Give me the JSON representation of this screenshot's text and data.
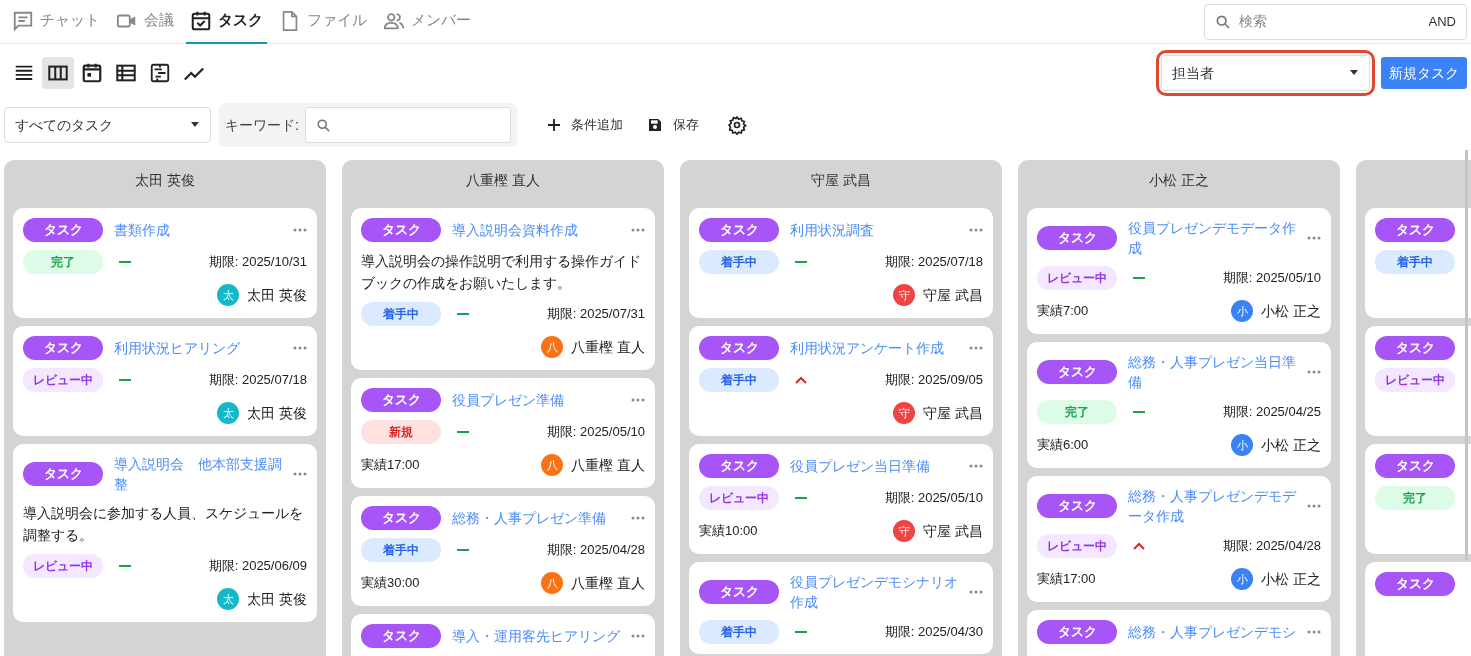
{
  "tabs": [
    {
      "label": "チャット",
      "kind": "chat",
      "selected": false
    },
    {
      "label": "会議",
      "kind": "video",
      "selected": false
    },
    {
      "label": "タスク",
      "kind": "task",
      "selected": true
    },
    {
      "label": "ファイル",
      "kind": "file",
      "selected": false
    },
    {
      "label": "メンバー",
      "kind": "members",
      "selected": false
    }
  ],
  "search": {
    "placeholder": "検索",
    "mode": "AND"
  },
  "view_modes": [
    {
      "kind": "list",
      "selected": false
    },
    {
      "kind": "board",
      "selected": true
    },
    {
      "kind": "calendar",
      "selected": false
    },
    {
      "kind": "table",
      "selected": false
    },
    {
      "kind": "gantt",
      "selected": false
    },
    {
      "kind": "chart",
      "selected": false
    }
  ],
  "group_by": {
    "value": "担当者",
    "highlighted": true
  },
  "new_task_button": "新規タスク",
  "filter": {
    "preset": "すべてのタスク",
    "keyword_label": "キーワード:",
    "add_condition": "条件追加",
    "save": "保存"
  },
  "columns": [
    {
      "title": "太田 英俊",
      "cards": [
        {
          "tag": "タスク",
          "title": "書類作成",
          "status": {
            "label": "完了",
            "kind": "done"
          },
          "priority": {
            "kind": "normal"
          },
          "due": "期限: 2025/10/31",
          "assignee": {
            "initial": "太",
            "name": "太田 英俊",
            "color": "#14b8c8"
          }
        },
        {
          "tag": "タスク",
          "title": "利用状況ヒアリング",
          "status": {
            "label": "レビュー中",
            "kind": "review"
          },
          "priority": {
            "kind": "normal"
          },
          "due": "期限: 2025/07/18",
          "assignee": {
            "initial": "太",
            "name": "太田 英俊",
            "color": "#14b8c8"
          }
        },
        {
          "tag": "タスク",
          "title": "導入説明会　他本部支援調整",
          "description": "導入説明会に参加する人員、スケジュールを調整する。",
          "status": {
            "label": "レビュー中",
            "kind": "review"
          },
          "priority": {
            "kind": "normal"
          },
          "due": "期限: 2025/06/09",
          "assignee": {
            "initial": "太",
            "name": "太田 英俊",
            "color": "#14b8c8"
          }
        }
      ]
    },
    {
      "title": "八重樫 直人",
      "cards": [
        {
          "tag": "タスク",
          "title": "導入説明会資料作成",
          "description": "導入説明会の操作説明で利用する操作ガイドブックの作成をお願いたします。",
          "status": {
            "label": "着手中",
            "kind": "in_progress"
          },
          "priority": {
            "kind": "normal"
          },
          "due": "期限: 2025/07/31",
          "assignee": {
            "initial": "八",
            "name": "八重樫 直人",
            "color": "#f97316"
          }
        },
        {
          "tag": "タスク",
          "title": "役員プレゼン準備",
          "status": {
            "label": "新規",
            "kind": "new"
          },
          "priority": {
            "kind": "normal"
          },
          "due": "期限: 2025/05/10",
          "actual": "実績17:00",
          "assignee": {
            "initial": "八",
            "name": "八重樫 直人",
            "color": "#f97316"
          }
        },
        {
          "tag": "タスク",
          "title": "総務・人事プレゼン準備",
          "status": {
            "label": "着手中",
            "kind": "in_progress"
          },
          "priority": {
            "kind": "normal"
          },
          "due": "期限: 2025/04/28",
          "actual": "実績30:00",
          "assignee": {
            "initial": "八",
            "name": "八重樫 直人",
            "color": "#f97316"
          }
        },
        {
          "tag": "タスク",
          "title": "導入・運用客先ヒアリング"
        }
      ]
    },
    {
      "title": "守屋 武昌",
      "cards": [
        {
          "tag": "タスク",
          "title": "利用状況調査",
          "status": {
            "label": "着手中",
            "kind": "in_progress"
          },
          "priority": {
            "kind": "normal"
          },
          "due": "期限: 2025/07/18",
          "assignee": {
            "initial": "守",
            "name": "守屋 武昌",
            "color": "#ef4444"
          }
        },
        {
          "tag": "タスク",
          "title": "利用状況アンケート作成",
          "status": {
            "label": "着手中",
            "kind": "in_progress"
          },
          "priority": {
            "kind": "high"
          },
          "due": "期限: 2025/09/05",
          "assignee": {
            "initial": "守",
            "name": "守屋 武昌",
            "color": "#ef4444"
          }
        },
        {
          "tag": "タスク",
          "title": "役員プレゼン当日準備",
          "status": {
            "label": "レビュー中",
            "kind": "review"
          },
          "priority": {
            "kind": "normal"
          },
          "due": "期限: 2025/05/10",
          "actual": "実績10:00",
          "assignee": {
            "initial": "守",
            "name": "守屋 武昌",
            "color": "#ef4444"
          }
        },
        {
          "tag": "タスク",
          "title": "役員プレゼンデモシナリオ作成",
          "status": {
            "label": "着手中",
            "kind": "in_progress"
          },
          "priority": {
            "kind": "normal"
          },
          "due": "期限: 2025/04/30"
        }
      ]
    },
    {
      "title": "小松 正之",
      "cards": [
        {
          "tag": "タスク",
          "title": "役員プレゼンデモデータ作成",
          "status": {
            "label": "レビュー中",
            "kind": "review"
          },
          "priority": {
            "kind": "normal"
          },
          "due": "期限: 2025/05/10",
          "actual": "実績7:00",
          "assignee": {
            "initial": "小",
            "name": "小松 正之",
            "color": "#3b82f6"
          }
        },
        {
          "tag": "タスク",
          "title": "総務・人事プレゼン当日準備",
          "status": {
            "label": "完了",
            "kind": "done"
          },
          "priority": {
            "kind": "normal"
          },
          "due": "期限: 2025/04/25",
          "actual": "実績6:00",
          "assignee": {
            "initial": "小",
            "name": "小松 正之",
            "color": "#3b82f6"
          }
        },
        {
          "tag": "タスク",
          "title": "総務・人事プレゼンデモデータ作成",
          "status": {
            "label": "レビュー中",
            "kind": "review"
          },
          "priority": {
            "kind": "high"
          },
          "due": "期限: 2025/04/28",
          "actual": "実績17:00",
          "assignee": {
            "initial": "小",
            "name": "小松 正之",
            "color": "#3b82f6"
          }
        },
        {
          "tag": "タスク",
          "title": "総務・人事プレゼンデモシ"
        }
      ]
    },
    {
      "cards": [
        {
          "tag": "タスク",
          "status": {
            "label": "着手中",
            "kind": "in_progress"
          }
        },
        {
          "tag": "タスク",
          "status": {
            "label": "レビュー中",
            "kind": "review"
          }
        },
        {
          "tag": "タスク",
          "status": {
            "label": "完了",
            "kind": "done"
          }
        },
        {
          "tag": "タスク"
        }
      ]
    }
  ]
}
